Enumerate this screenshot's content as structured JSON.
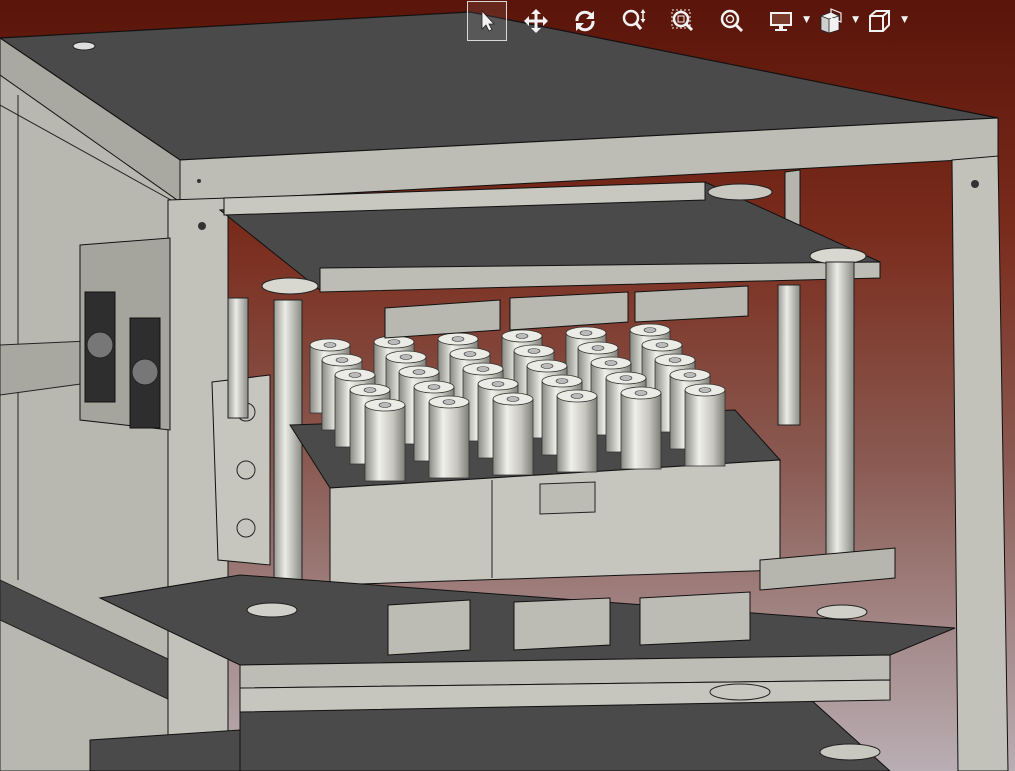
{
  "toolbar": {
    "tools": [
      {
        "name": "select-tool",
        "icon": "arrow-cursor-icon",
        "active": true
      },
      {
        "name": "pan-tool",
        "icon": "move-arrows-icon",
        "active": false
      },
      {
        "name": "rotate-tool",
        "icon": "rotate-icon",
        "active": false
      },
      {
        "name": "zoom-tool",
        "icon": "zoom-updown-icon",
        "active": false
      },
      {
        "name": "zoom-box-tool",
        "icon": "zoom-box-icon",
        "active": false
      },
      {
        "name": "zoom-fit-tool",
        "icon": "zoom-fit-icon",
        "active": false
      },
      {
        "name": "display-mode-dropdown",
        "icon": "monitor-icon",
        "dropdown": true
      },
      {
        "name": "section-view-dropdown",
        "icon": "section-cube-icon",
        "dropdown": true
      },
      {
        "name": "view-orientation-dropdown",
        "icon": "cube-icon",
        "dropdown": true
      }
    ]
  },
  "colors": {
    "background_top": "#5a1409",
    "background_bottom": "#b9aeb4",
    "frame_light": "#b4b4ac",
    "plate_dark": "#4a4a4a",
    "toolbar_icon": "#f2f2f2"
  }
}
